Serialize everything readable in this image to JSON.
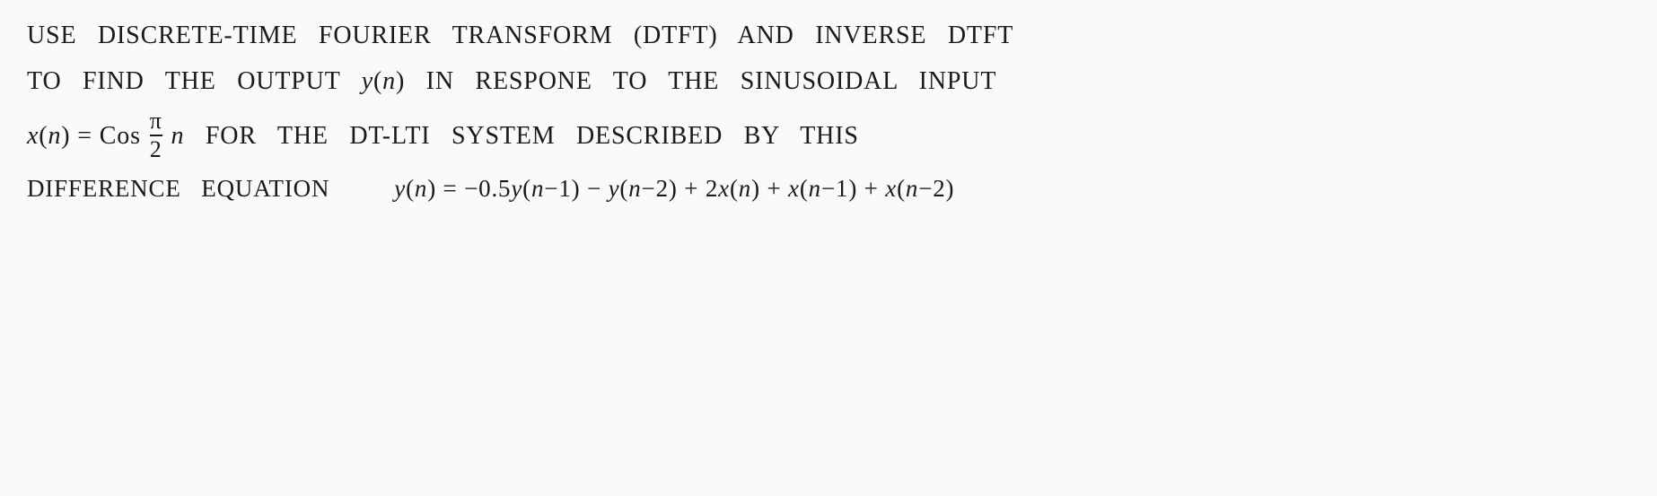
{
  "page": {
    "background": "#fafaf8",
    "lines": [
      {
        "id": "line1",
        "text": "USE  DISCRETE-TIME  FOURIER  TRANSFORM  (DTFT)  AND  INVERSE  DTFT"
      },
      {
        "id": "line2",
        "text": "TO  FIND  THE  OUTPUT  y(n)  IN  RESPONE  TO  THE  SINUSOIDAL  INPUT"
      },
      {
        "id": "line3",
        "text": "x(n) = Cos π/2 n  FOR  THE  DT-LTI  SYSTEM  DESCRIBED  BY  THIS"
      },
      {
        "id": "line4-label",
        "text": "DIFFERENCE  EQUATION"
      },
      {
        "id": "line4-eq",
        "text": "y(n) = -0.5y(n-1) - y(n-2) + 2x(n) + x(n-1) + x(n-2)"
      }
    ]
  }
}
